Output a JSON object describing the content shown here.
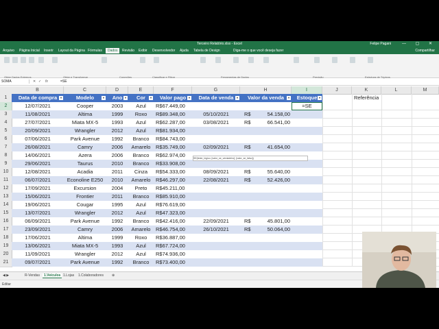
{
  "window": {
    "title": "Terceiro Relatório.xlsx - Excel",
    "user": "Felipe Pagani",
    "controls": "— ▢ ✕"
  },
  "ribbon": {
    "tabs": [
      "Arquivo",
      "Página Inicial",
      "Inserir",
      "Layout da Página",
      "Fórmulas",
      "Dados",
      "Revisão",
      "Exibir",
      "Desenvolvedor",
      "Ajuda",
      "Tabela de Design"
    ],
    "active_tab": "Dados",
    "tell_me": "Diga-me o que você deseja fazer",
    "share": "Compartilhar",
    "groups": [
      "Obter Dados Externos",
      "Obter e Transformar",
      "Conexões",
      "Classificar e Filtrar",
      "Ferramentas de Dados",
      "Previsão",
      "Estrutura de Tópicos"
    ]
  },
  "formula_bar": {
    "name_box": "SOMA",
    "cancel": "✕",
    "enter": "✓",
    "fx": "fx",
    "content": "=SE"
  },
  "columns": [
    "A",
    "B",
    "C",
    "D",
    "E",
    "F",
    "G",
    "H",
    "I",
    "J",
    "K",
    "L",
    "M"
  ],
  "selected_column": "I",
  "table_headers": [
    "Data de compra",
    "Modelo",
    "Ano",
    "Cor",
    "Valor pago",
    "Data de venda",
    "Valor da venda",
    "Estoque"
  ],
  "k_header": "Referência",
  "currency": "R$",
  "rows": [
    {
      "n": "2",
      "data": "12/07/2021",
      "modelo": "Cooper",
      "ano": "2003",
      "cor": "Azul",
      "pago": "R$67.449,00",
      "dv": "",
      "vv": "",
      "est": "=SE"
    },
    {
      "n": "3",
      "data": "11/08/2021",
      "modelo": "Altima",
      "ano": "1999",
      "cor": "Roxo",
      "pago": "R$89.348,00",
      "dv": "05/10/2021",
      "vv": "54.158,00",
      "est": ""
    },
    {
      "n": "4",
      "data": "27/07/2021",
      "modelo": "Miata MX-5",
      "ano": "1993",
      "cor": "Azul",
      "pago": "R$62.287,00",
      "dv": "03/08/2021",
      "vv": "66.541,00",
      "est": ""
    },
    {
      "n": "5",
      "data": "20/09/2021",
      "modelo": "Wrangler",
      "ano": "2012",
      "cor": "Azul",
      "pago": "R$81.934,00",
      "dv": "",
      "vv": "",
      "est": ""
    },
    {
      "n": "6",
      "data": "07/06/2021",
      "modelo": "Park Avenue",
      "ano": "1992",
      "cor": "Branco",
      "pago": "R$84.743,00",
      "dv": "",
      "vv": "",
      "est": ""
    },
    {
      "n": "7",
      "data": "26/08/2021",
      "modelo": "Camry",
      "ano": "2006",
      "cor": "Amarelo",
      "pago": "R$35.749,00",
      "dv": "02/09/2021",
      "vv": "41.654,00",
      "est": ""
    },
    {
      "n": "8",
      "data": "14/06/2021",
      "modelo": "Azera",
      "ano": "2006",
      "cor": "Branco",
      "pago": "R$62.974,00",
      "dv": "",
      "vv": "",
      "est": ""
    },
    {
      "n": "9",
      "data": "29/06/2021",
      "modelo": "Taurus",
      "ano": "2010",
      "cor": "Branco",
      "pago": "R$33.908,00",
      "dv": "",
      "vv": "",
      "est": ""
    },
    {
      "n": "10",
      "data": "12/08/2021",
      "modelo": "Acadia",
      "ano": "2011",
      "cor": "Cinza",
      "pago": "R$54.333,00",
      "dv": "08/09/2021",
      "vv": "55.640,00",
      "est": ""
    },
    {
      "n": "11",
      "data": "06/07/2021",
      "modelo": "Econoline E250",
      "ano": "2010",
      "cor": "Amarelo",
      "pago": "R$46.297,00",
      "dv": "22/08/2021",
      "vv": "52.426,00",
      "est": ""
    },
    {
      "n": "12",
      "data": "17/09/2021",
      "modelo": "Excursion",
      "ano": "2004",
      "cor": "Preto",
      "pago": "R$45.211,00",
      "dv": "",
      "vv": "",
      "est": ""
    },
    {
      "n": "13",
      "data": "15/06/2021",
      "modelo": "Frontier",
      "ano": "2011",
      "cor": "Branco",
      "pago": "R$85.910,00",
      "dv": "",
      "vv": "",
      "est": ""
    },
    {
      "n": "14",
      "data": "19/06/2021",
      "modelo": "Cougar",
      "ano": "1995",
      "cor": "Azul",
      "pago": "R$76.619,00",
      "dv": "",
      "vv": "",
      "est": ""
    },
    {
      "n": "15",
      "data": "13/07/2021",
      "modelo": "Wrangler",
      "ano": "2012",
      "cor": "Azul",
      "pago": "R$47.323,00",
      "dv": "",
      "vv": "",
      "est": ""
    },
    {
      "n": "16",
      "data": "06/09/2021",
      "modelo": "Park Avenue",
      "ano": "1992",
      "cor": "Branco",
      "pago": "R$42.416,00",
      "dv": "22/09/2021",
      "vv": "45.801,00",
      "est": ""
    },
    {
      "n": "17",
      "data": "23/09/2021",
      "modelo": "Camry",
      "ano": "2006",
      "cor": "Amarelo",
      "pago": "R$46.754,00",
      "dv": "26/10/2021",
      "vv": "50.064,00",
      "est": ""
    },
    {
      "n": "18",
      "data": "17/06/2021",
      "modelo": "Altima",
      "ano": "1999",
      "cor": "Roxo",
      "pago": "R$36.887,00",
      "dv": "",
      "vv": "",
      "est": ""
    },
    {
      "n": "19",
      "data": "13/06/2021",
      "modelo": "Miata MX-5",
      "ano": "1993",
      "cor": "Azul",
      "pago": "R$67.724,00",
      "dv": "",
      "vv": "",
      "est": ""
    },
    {
      "n": "20",
      "data": "11/09/2021",
      "modelo": "Wrangler",
      "ano": "2012",
      "cor": "Azul",
      "pago": "R$74.936,00",
      "dv": "",
      "vv": "",
      "est": ""
    },
    {
      "n": "21",
      "data": "09/07/2021",
      "modelo": "Park Avenue",
      "ano": "1992",
      "cor": "Branco",
      "pago": "R$73.400,00",
      "dv": "",
      "vv": "",
      "est": ""
    }
  ],
  "tooltip": "SE(teste_lógico; [valor_se_verdadeiro]; [valor_se_falso])",
  "sheets": [
    "R-Vendas",
    "1.Veículos",
    "1.Lojas",
    "1.Colaboradores"
  ],
  "active_sheet": "1.Veículos",
  "add_sheet": "⊕",
  "status": "Editar",
  "colors": {
    "accent": "#217346",
    "header_blue": "#4472c4",
    "band_blue": "#d9e1f2"
  }
}
